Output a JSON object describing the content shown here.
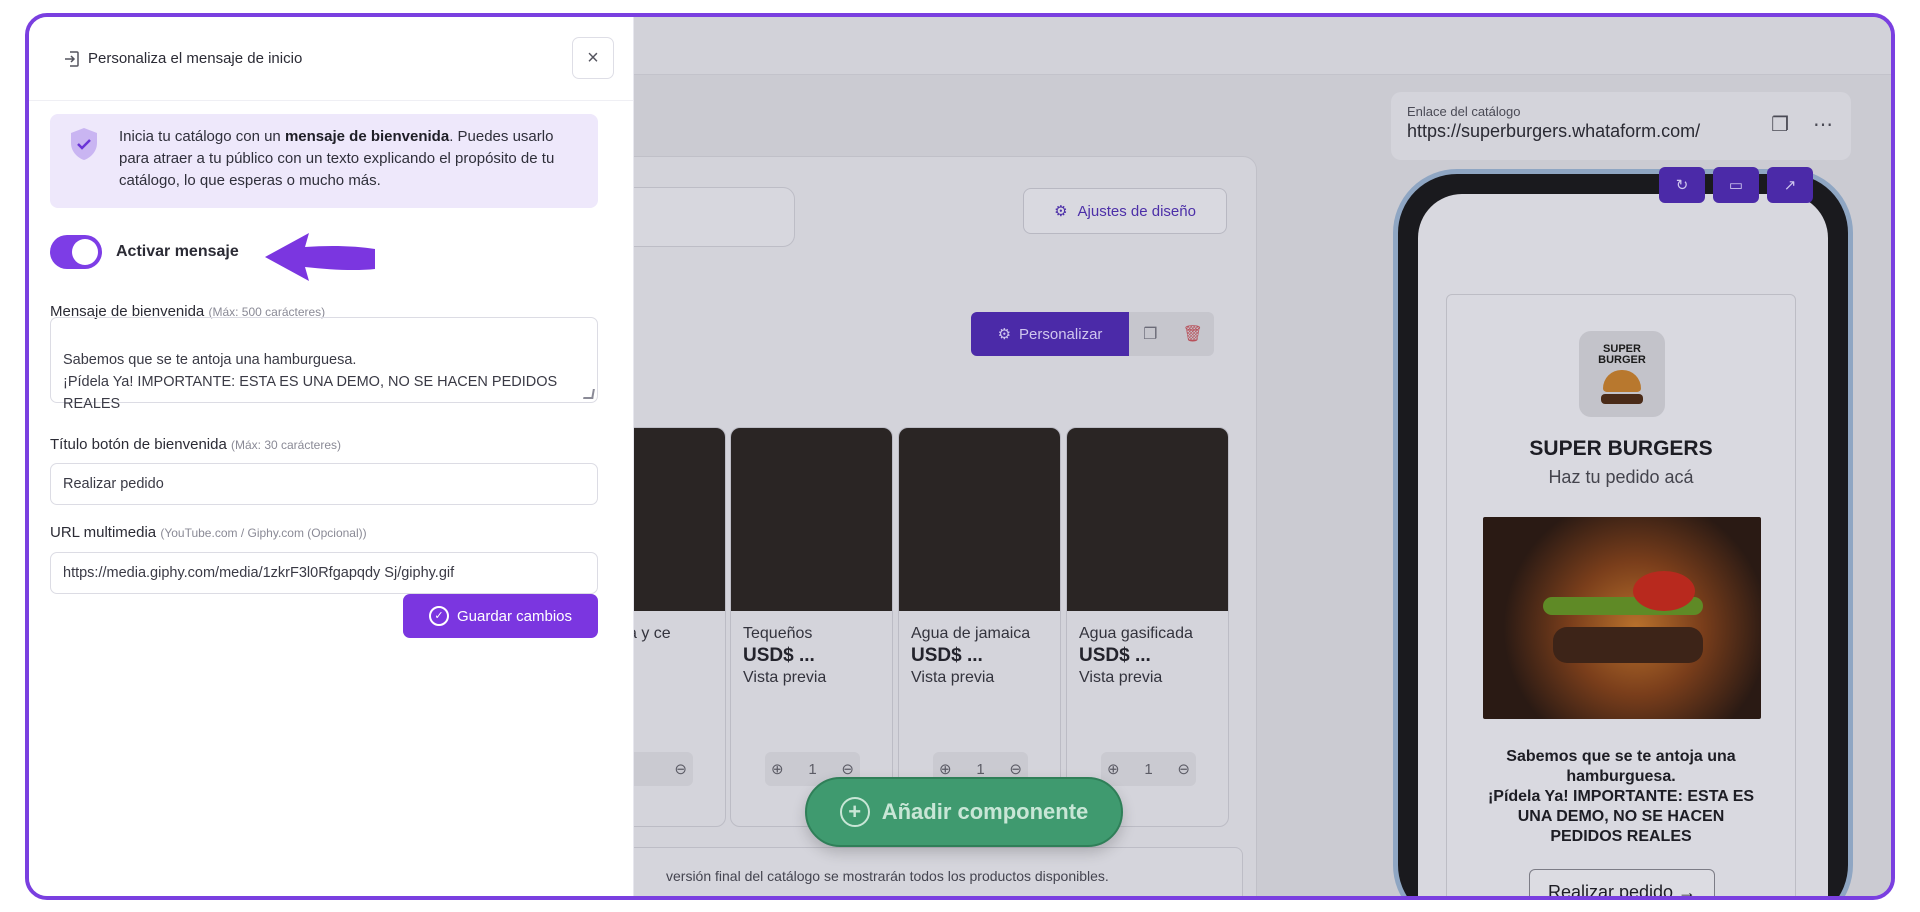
{
  "panel": {
    "title": "Personaliza el mensaje de inicio",
    "close_label": "×",
    "info_pre": "Inicia tu catálogo con un ",
    "info_bold": "mensaje de bienvenida",
    "info_post": ". Puedes usarlo para atraer a tu público con un texto explicando el propósito de tu catálogo, lo que esperas o mucho más.",
    "toggle_label": "Activar mensaje",
    "toggle_on": true,
    "welcome_label": "Mensaje de bienvenida",
    "welcome_hint": "(Máx: 500 carácteres)",
    "welcome_value": "Sabemos que se te antoja una hamburguesa.\n¡Pídela Ya! IMPORTANTE: ESTA ES UNA DEMO, NO SE HACEN PEDIDOS REALES",
    "button_title_label": "Título botón de bienvenida",
    "button_title_hint": "(Máx: 30 carácteres)",
    "button_title_value": "Realizar pedido",
    "media_label": "URL multimedia",
    "media_hint": "(YouTube.com / Giphy.com (Opcional))",
    "media_value": "https://media.giphy.com/media/1zkrF3l0Rfgapqdy Sj/giphy.gif",
    "save_label": "Guardar cambios"
  },
  "background": {
    "design_settings_label": "Ajustes de diseño",
    "customize_label": "Personalizar",
    "products": [
      {
        "name": "sa y ce",
        "price": "",
        "preview": ""
      },
      {
        "name": "Tequeños",
        "price": "USD$ ...",
        "preview": "Vista previa"
      },
      {
        "name": "Agua de jamaica",
        "price": "USD$ ...",
        "preview": "Vista previa"
      },
      {
        "name": "Agua gasificada",
        "price": "USD$ ...",
        "preview": "Vista previa"
      }
    ],
    "stepper_value": "1",
    "notice": "versión final del catálogo se mostrarán todos los productos disponibles.",
    "add_component_label": "Añadir componente",
    "catalog_link_label": "Enlace del catálogo",
    "catalog_link_value": "https://superburgers.whataform.com/"
  },
  "preview": {
    "brand_title": "SUPER BURGERS",
    "brand_subtitle": "Haz tu pedido acá",
    "logo_text_1": "SUPER",
    "logo_text_2": "BURGER",
    "welcome_text": "Sabemos que se te antoja una hamburguesa.\n¡Pídela Ya! IMPORTANTE: ESTA ES UNA DEMO, NO SE HACEN PEDIDOS REALES",
    "cta_label": "Realizar pedido →"
  },
  "colors": {
    "accent": "#7b36e0",
    "frame": "#7a3fe0",
    "green": "#3f9a6f"
  }
}
